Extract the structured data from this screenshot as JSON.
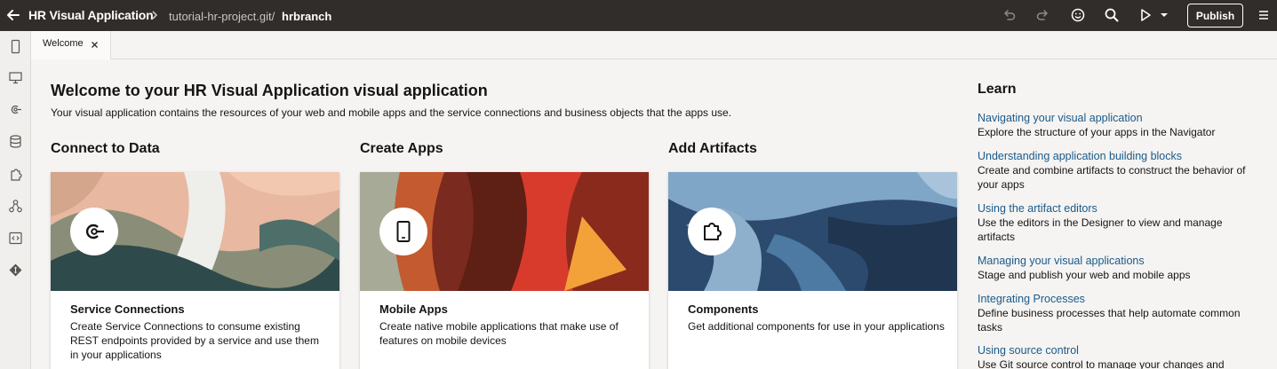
{
  "header": {
    "app_title": "HR Visual Application",
    "repo": "tutorial-hr-project.git/",
    "branch": "hrbranch",
    "publish_label": "Publish"
  },
  "tabs": [
    {
      "label": "Welcome"
    }
  ],
  "welcome": {
    "title": "Welcome to your HR Visual Application visual application",
    "description": "Your visual application contains the resources of your web and mobile apps and the service connections and business objects that the apps use."
  },
  "sections": {
    "connect": {
      "heading": "Connect to Data",
      "card_title": "Service Connections",
      "card_desc": "Create Service Connections to consume existing REST endpoints provided by a service and use them in your applications"
    },
    "create": {
      "heading": "Create Apps",
      "card_title": "Mobile Apps",
      "card_desc": "Create native mobile applications that make use of features on mobile devices"
    },
    "artifacts": {
      "heading": "Add Artifacts",
      "card_title": "Components",
      "card_desc": "Get additional components for use in your applications"
    }
  },
  "learn": {
    "heading": "Learn",
    "items": [
      {
        "link": "Navigating your visual application",
        "desc": "Explore the structure of your apps in the Navigator"
      },
      {
        "link": "Understanding application building blocks",
        "desc": "Create and combine artifacts to construct the behavior of your apps"
      },
      {
        "link": "Using the artifact editors",
        "desc": "Use the editors in the Designer to view and manage artifacts"
      },
      {
        "link": "Managing your visual applications",
        "desc": "Stage and publish your web and mobile apps"
      },
      {
        "link": "Integrating Processes",
        "desc": "Define business processes that help automate common tasks"
      },
      {
        "link": "Using source control",
        "desc": "Use Git source control to manage your changes and"
      }
    ]
  },
  "icons": {
    "rail": [
      "mobile-icon",
      "desktop-icon",
      "service-connection-icon",
      "business-objects-icon",
      "components-icon",
      "processes-icon",
      "source-icon",
      "git-icon"
    ]
  },
  "colors": {
    "header_bg": "#312d2a",
    "link": "#1a5a8a",
    "page_bg": "#f5f4f2"
  }
}
